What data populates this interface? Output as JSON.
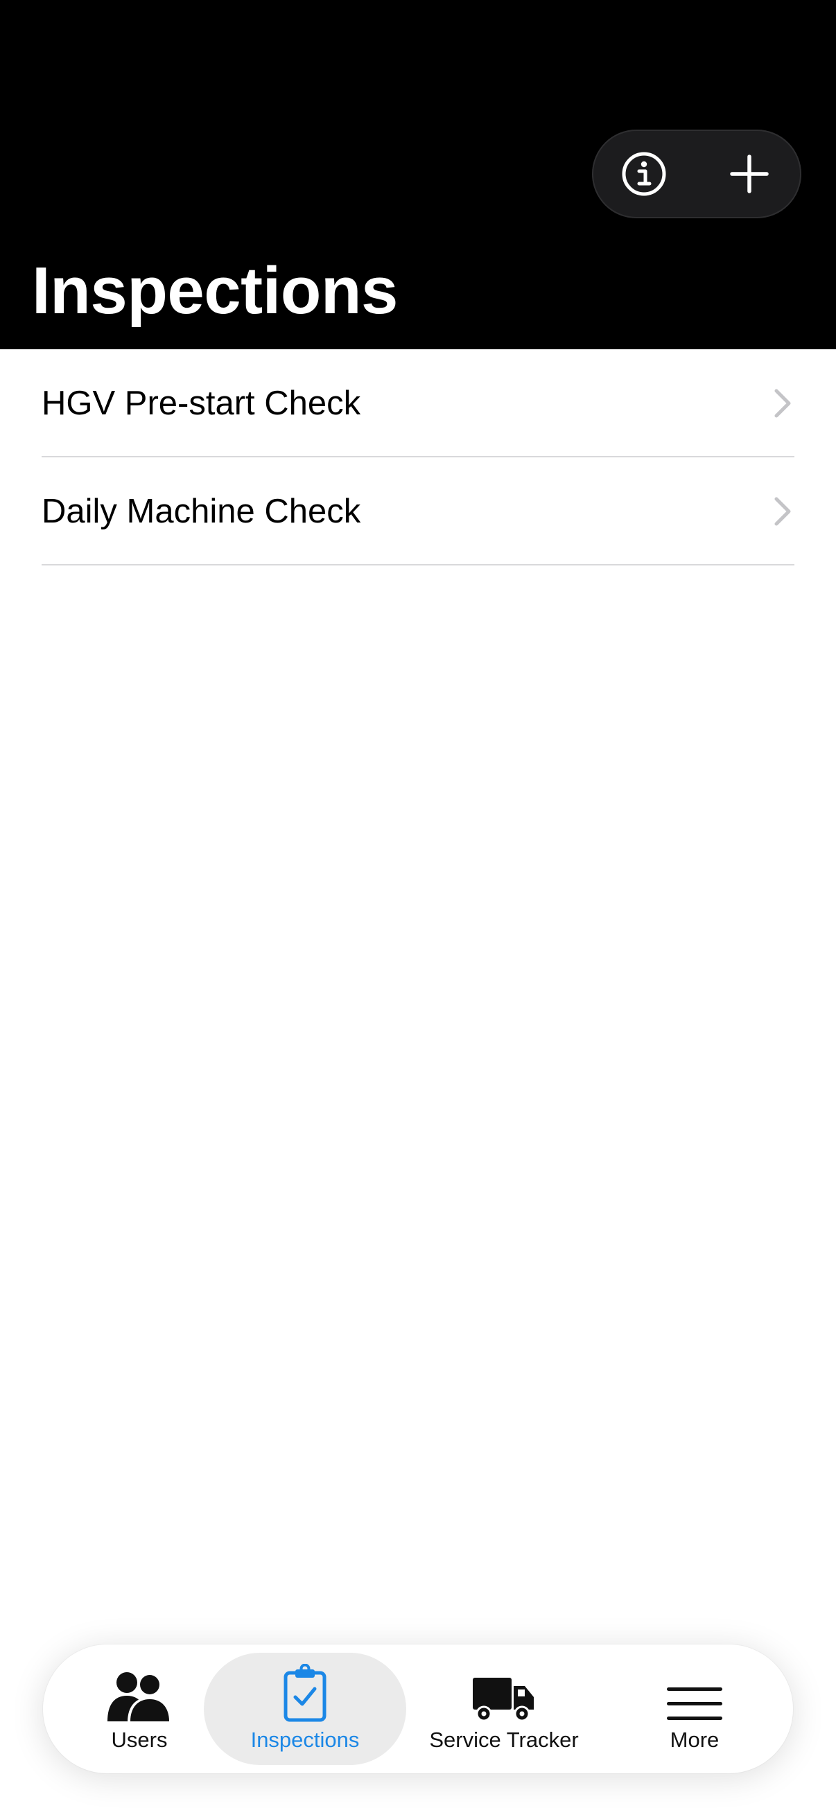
{
  "header": {
    "title": "Inspections",
    "actions": {
      "info_icon": "info-circle-icon",
      "add_icon": "plus-icon"
    }
  },
  "list": {
    "items": [
      {
        "label": "HGV Pre-start Check",
        "icon": "chevron-right-icon"
      },
      {
        "label": "Daily Machine Check",
        "icon": "chevron-right-icon"
      }
    ]
  },
  "tab_bar": {
    "tabs": [
      {
        "label": "Users",
        "icon": "users-icon",
        "active": false
      },
      {
        "label": "Inspections",
        "icon": "clipboard-check-icon",
        "active": true
      },
      {
        "label": "Service Tracker",
        "icon": "truck-icon",
        "active": false
      },
      {
        "label": "More",
        "icon": "menu-icon",
        "active": false
      }
    ]
  },
  "colors": {
    "header_background": "#000000",
    "accent": "#1b87e6",
    "active_tab_background": "#ebebeb",
    "divider": "#d9d9db"
  }
}
